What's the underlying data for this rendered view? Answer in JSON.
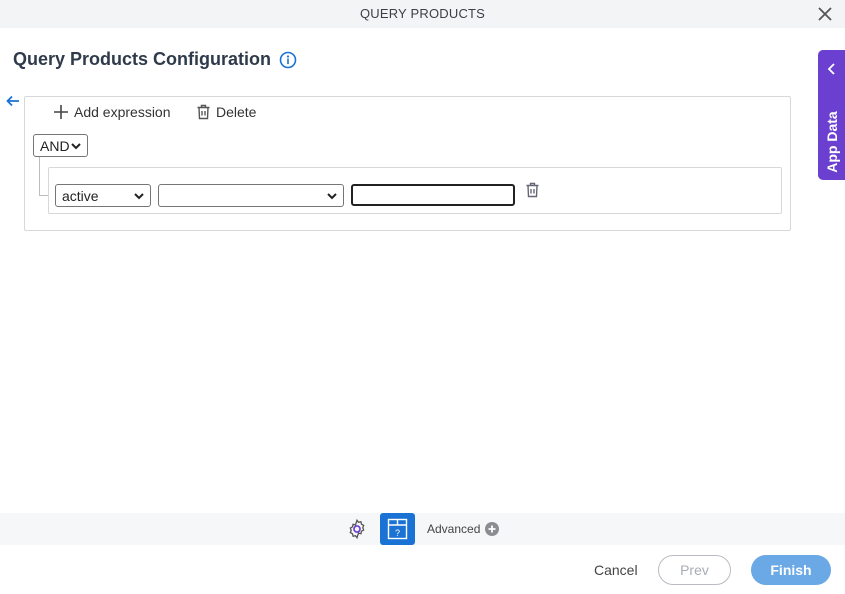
{
  "window": {
    "title": "QUERY PRODUCTS"
  },
  "header": {
    "title": "Query Products Configuration"
  },
  "toolbar": {
    "add_expression_label": "Add expression",
    "delete_label": "Delete"
  },
  "group": {
    "operator": "AND"
  },
  "expression": {
    "field": "active",
    "condition": "",
    "value": ""
  },
  "side_panel": {
    "label": "App Data"
  },
  "footer": {
    "advanced_label": "Advanced",
    "cancel_label": "Cancel",
    "prev_label": "Prev",
    "finish_label": "Finish"
  },
  "colors": {
    "accent": "#1a73d4",
    "app_data": "#6b3fcf",
    "finish": "#6aa8e6"
  }
}
